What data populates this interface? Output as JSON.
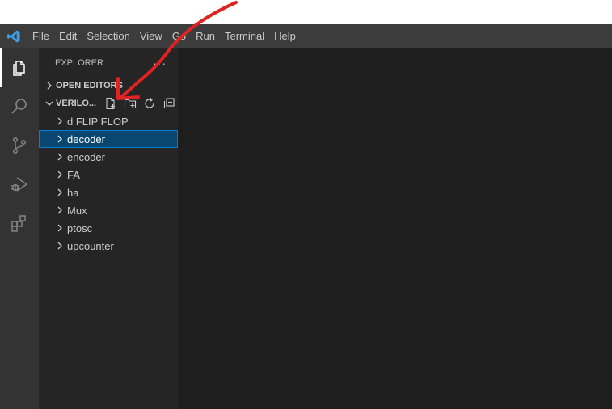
{
  "menu": {
    "items": [
      "File",
      "Edit",
      "Selection",
      "View",
      "Go",
      "Run",
      "Terminal",
      "Help"
    ]
  },
  "activity_bar": {
    "icons": [
      "explorer-icon",
      "search-icon",
      "source-control-icon",
      "run-debug-icon",
      "extensions-icon"
    ]
  },
  "sidebar": {
    "title": "EXPLORER",
    "more": "···",
    "open_editors": "OPEN EDITORS",
    "workspace": "VERILO...",
    "folders": [
      "d FLIP FLOP",
      "decoder",
      "encoder",
      "FA",
      "ha",
      "Mux",
      "ptosc",
      "upcounter"
    ],
    "selected_folder": "decoder"
  },
  "colors": {
    "accent": "#007fd4",
    "selection": "#094771",
    "annotation": "#e02222"
  }
}
